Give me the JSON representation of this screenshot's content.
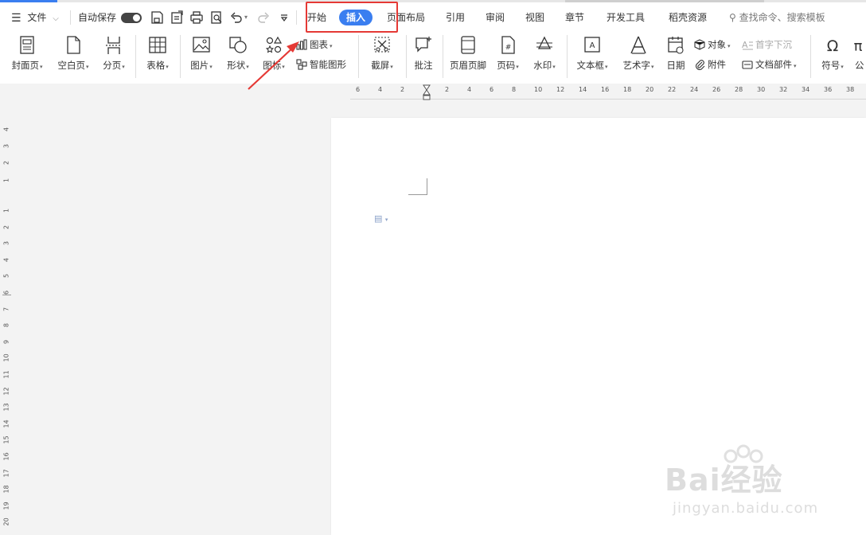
{
  "menu": {
    "file_label": "文件",
    "autosave_label": "自动保存"
  },
  "tabs": [
    "开始",
    "插入",
    "页面布局",
    "引用",
    "审阅",
    "视图",
    "章节",
    "开发工具",
    "稻壳资源"
  ],
  "active_tab": "插入",
  "search": {
    "placeholder": "查找命令、搜索模板"
  },
  "ribbon": {
    "cover": "封面页",
    "blank": "空白页",
    "pagebreak": "分页",
    "table": "表格",
    "picture": "图片",
    "shape": "形状",
    "icon": "图标",
    "chart": "图表",
    "smartart": "智能图形",
    "screenshot": "截屏",
    "comment": "批注",
    "headerfooter": "页眉页脚",
    "pagenum": "页码",
    "watermark": "水印",
    "textbox": "文本框",
    "wordart": "艺术字",
    "date": "日期",
    "object": "对象",
    "dropcap": "首字下沉",
    "attachment": "附件",
    "docparts": "文档部件",
    "symbol": "符号",
    "formula": "公"
  },
  "hruler_labels": [
    "6",
    "4",
    "2",
    "2",
    "4",
    "6",
    "8",
    "10",
    "12",
    "14",
    "16",
    "18",
    "20",
    "22",
    "24",
    "26",
    "28",
    "30",
    "32",
    "34",
    "36",
    "38"
  ],
  "vruler_top_labels": [
    "4",
    "3",
    "2",
    "1"
  ],
  "vruler_labels": [
    "1",
    "2",
    "3",
    "4",
    "5",
    "6",
    "7",
    "8",
    "9",
    "10",
    "11",
    "12",
    "13",
    "14",
    "15",
    "16",
    "17",
    "18",
    "19",
    "20"
  ],
  "watermark": {
    "brand": "Bai经验",
    "url": "jingyan.baidu.com"
  },
  "colors": {
    "accent": "#3a7ef0",
    "highlight": "#e53935"
  }
}
